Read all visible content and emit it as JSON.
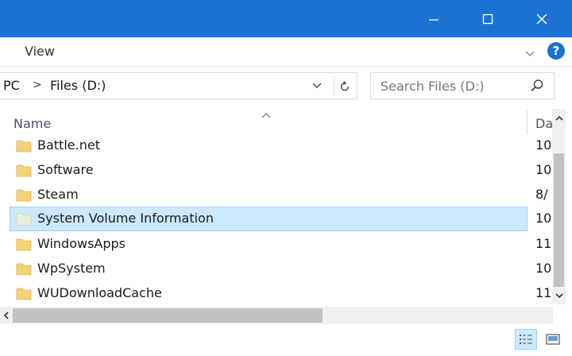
{
  "window": {
    "controls": {
      "minimize_icon": "minimize-icon",
      "maximize_icon": "maximize-icon",
      "close_icon": "close-icon"
    },
    "accent_color": "#1c72d3"
  },
  "ribbon": {
    "view_tab": "View",
    "help_label": "?"
  },
  "address": {
    "crumbs": [
      "PC",
      "Files (D:)"
    ],
    "separator": ">"
  },
  "search": {
    "placeholder": "Search Files (D:)"
  },
  "columns": {
    "name": "Name",
    "date": "Date modified"
  },
  "files": [
    {
      "name": "Battle.net",
      "date": "10",
      "selected": false
    },
    {
      "name": "Software",
      "date": "10",
      "selected": false
    },
    {
      "name": "Steam",
      "date": "8/",
      "selected": false
    },
    {
      "name": "System Volume Information",
      "date": "10",
      "selected": true
    },
    {
      "name": "WindowsApps",
      "date": "11",
      "selected": false
    },
    {
      "name": "WpSystem",
      "date": "10",
      "selected": false
    },
    {
      "name": "WUDownloadCache",
      "date": "11",
      "selected": false
    }
  ],
  "colors": {
    "selection_bg": "#cce8ff",
    "selection_border": "#99d1ff",
    "folder": "#f5d37a"
  }
}
